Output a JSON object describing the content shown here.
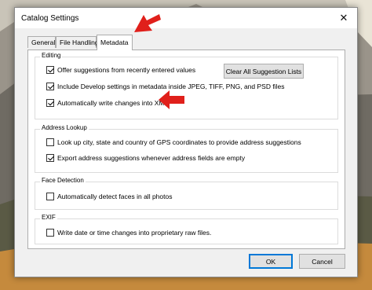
{
  "dialog": {
    "title": "Catalog Settings",
    "close_glyph": "✕"
  },
  "tabs": [
    {
      "label": "General",
      "active": false
    },
    {
      "label": "File Handling",
      "active": false
    },
    {
      "label": "Metadata",
      "active": true
    }
  ],
  "editing": {
    "title": "Editing",
    "options": [
      {
        "label": "Offer suggestions from recently entered values",
        "checked": true
      },
      {
        "label": "Include Develop settings in metadata inside JPEG, TIFF, PNG, and PSD files",
        "checked": true
      },
      {
        "label": "Automatically write changes into XMP",
        "checked": true
      }
    ],
    "clear_button": "Clear All Suggestion Lists"
  },
  "address_lookup": {
    "title": "Address Lookup",
    "options": [
      {
        "label": "Look up city, state and country of GPS coordinates to provide address suggestions",
        "checked": false
      },
      {
        "label": "Export address suggestions whenever address fields are empty",
        "checked": true
      }
    ]
  },
  "face_detection": {
    "title": "Face Detection",
    "options": [
      {
        "label": "Automatically detect faces in all photos",
        "checked": false
      }
    ]
  },
  "exif": {
    "title": "EXIF",
    "options": [
      {
        "label": "Write date or time changes into proprietary raw files.",
        "checked": false
      }
    ]
  },
  "footer": {
    "ok": "OK",
    "cancel": "Cancel"
  },
  "colors": {
    "annotation_arrow": "#e0201b",
    "accent": "#0078d7"
  }
}
